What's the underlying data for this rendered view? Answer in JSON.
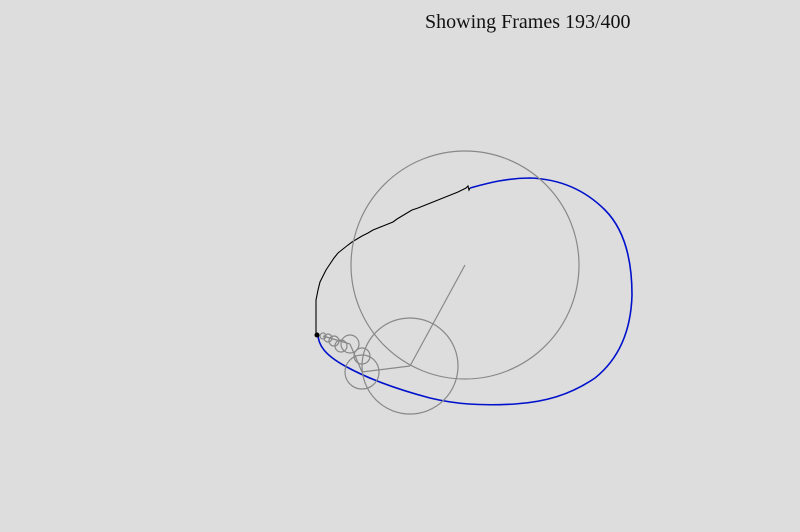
{
  "status": {
    "frame_text": "Showing Frames 193/400"
  },
  "colors": {
    "background": "#dddddd",
    "epicycle_stroke": "#888888",
    "traced_path": "#000000",
    "target_path": "#0011cc"
  }
}
